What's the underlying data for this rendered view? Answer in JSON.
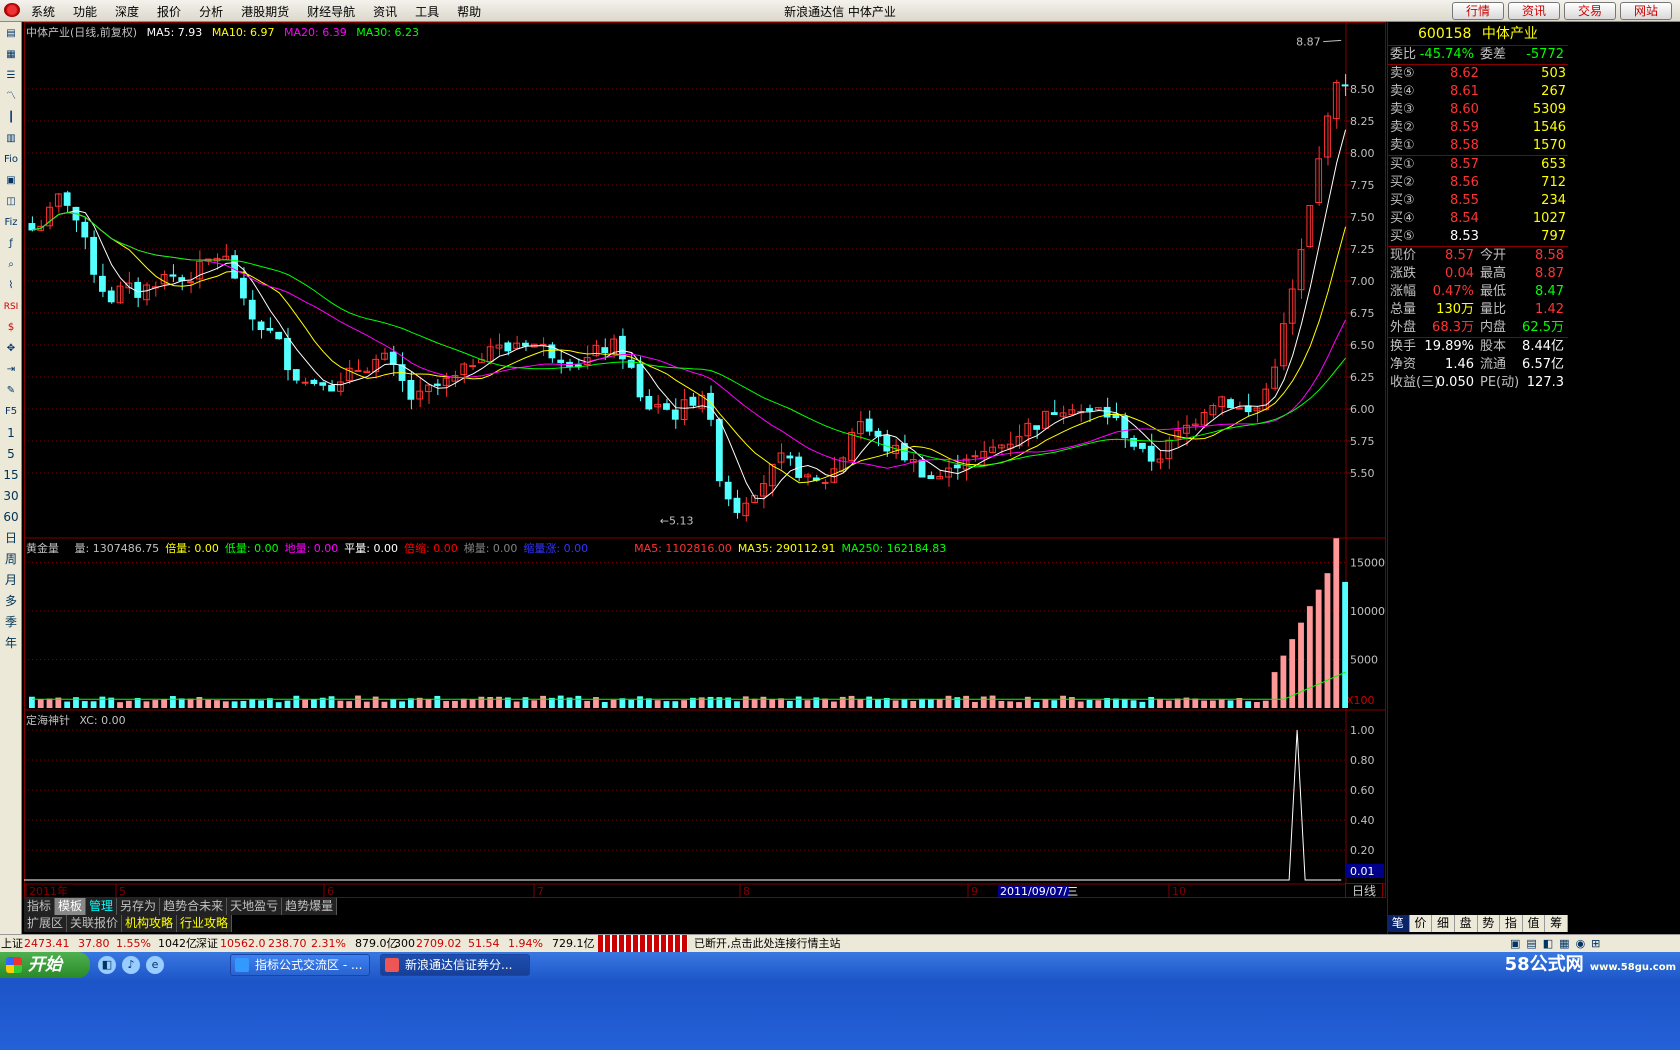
{
  "menu": {
    "items": [
      "系统",
      "功能",
      "深度",
      "报价",
      "分析",
      "港股期货",
      "财经导航",
      "资讯",
      "工具",
      "帮助"
    ],
    "title": "新浪通达信  中体产业",
    "buttons": [
      "行情",
      "资讯",
      "交易",
      "网站"
    ]
  },
  "left_tools": {
    "icons": [
      "page-icon",
      "grid-icon",
      "list-icon",
      "line-chart-icon",
      "candle-chart-icon",
      "table-icon",
      "f10-icon",
      "calc-icon",
      "info-icon",
      "fiz-icon",
      "fx-icon",
      "search-icon",
      "tick-icon",
      "rsi-icon",
      "money-icon",
      "move-icon",
      "export-icon",
      "pencil-icon",
      "f5-icon"
    ],
    "labels": [
      "Fio",
      "Fiz",
      "RSI",
      "F5"
    ],
    "periods": [
      "1",
      "5",
      "15",
      "30",
      "60"
    ],
    "periods2": [
      "日",
      "周",
      "月",
      "多",
      "季",
      "年"
    ]
  },
  "kline": {
    "name": "中体产业(日线,前复权)",
    "ma5": "MA5: 7.93",
    "ma10": "MA10: 6.97",
    "ma20": "MA20: 6.39",
    "ma30": "MA30: 6.23",
    "high_label": "8.87",
    "low_label": "5.13",
    "price_ticks": [
      "8.50",
      "8.25",
      "8.00",
      "7.75",
      "7.50",
      "7.25",
      "7.00",
      "6.75",
      "6.50",
      "6.25",
      "6.00",
      "5.75",
      "5.50"
    ]
  },
  "volume": {
    "name": "黄金量",
    "fields": [
      {
        "label": "量: 1307486.75",
        "color": "#c0c0c0"
      },
      {
        "label": "倍量: 0.00",
        "color": "#ffff00"
      },
      {
        "label": "低量: 0.00",
        "color": "#00ff00"
      },
      {
        "label": "地量: 0.00",
        "color": "#ff00ff"
      },
      {
        "label": "平量: 0.00",
        "color": "#ffffff"
      },
      {
        "label": "倍缩: 0.00",
        "color": "#ff0000"
      },
      {
        "label": "梯量: 0.00",
        "color": "#808080"
      },
      {
        "label": "缩量涨: 0.00",
        "color": "#3333ff"
      },
      {
        "label": "MA5: 1102816.00",
        "color": "#ff3333"
      },
      {
        "label": "MA35: 290112.91",
        "color": "#ffff00"
      },
      {
        "label": "MA250: 162184.83",
        "color": "#00ff00"
      }
    ],
    "ticks": [
      "15000",
      "10000",
      "5000"
    ],
    "unit": "X100"
  },
  "indicator": {
    "name": "定海神针",
    "xc": "XC: 0.00",
    "ticks": [
      "1.00",
      "0.80",
      "0.60",
      "0.40",
      "0.20"
    ],
    "cur_value": "0.01"
  },
  "date_axis": {
    "labels": [
      "2011年",
      "5",
      "6",
      "7",
      "8",
      "9",
      "10"
    ],
    "highlight": "2011/09/07/三",
    "period": "日线"
  },
  "bottom_tabs": {
    "row1": [
      "指标",
      "模板",
      "管理",
      "另存为",
      "趋势合未来",
      "天地盈亏",
      "趋势爆量"
    ],
    "row2": [
      "扩展区",
      "关联报价",
      "机构攻略",
      "行业攻略"
    ]
  },
  "quote": {
    "code": "600158",
    "name": "中体产业",
    "weibi_label": "委比",
    "weibi": "-45.74%",
    "weicha_label": "委差",
    "weicha": "-5772",
    "sells": [
      {
        "label": "卖⑤",
        "price": "8.62",
        "vol": "503"
      },
      {
        "label": "卖④",
        "price": "8.61",
        "vol": "267"
      },
      {
        "label": "卖③",
        "price": "8.60",
        "vol": "5309"
      },
      {
        "label": "卖②",
        "price": "8.59",
        "vol": "1546"
      },
      {
        "label": "卖①",
        "price": "8.58",
        "vol": "1570"
      }
    ],
    "buys": [
      {
        "label": "买①",
        "price": "8.57",
        "vol": "653"
      },
      {
        "label": "买②",
        "price": "8.56",
        "vol": "712"
      },
      {
        "label": "买③",
        "price": "8.55",
        "vol": "234"
      },
      {
        "label": "买④",
        "price": "8.54",
        "vol": "1027"
      },
      {
        "label": "买⑤",
        "price": "8.53",
        "vol": "797"
      }
    ],
    "stats": [
      [
        {
          "l": "现价",
          "v": "8.57",
          "c": "red"
        },
        {
          "l": "今开",
          "v": "8.58",
          "c": "red"
        }
      ],
      [
        {
          "l": "涨跌",
          "v": "0.04",
          "c": "red"
        },
        {
          "l": "最高",
          "v": "8.87",
          "c": "red"
        }
      ],
      [
        {
          "l": "涨幅",
          "v": "0.47%",
          "c": "red"
        },
        {
          "l": "最低",
          "v": "8.47",
          "c": "green"
        }
      ],
      [
        {
          "l": "总量",
          "v": "130万",
          "c": "yellow"
        },
        {
          "l": "量比",
          "v": "1.42",
          "c": "red"
        }
      ],
      [
        {
          "l": "外盘",
          "v": "68.3万",
          "c": "red"
        },
        {
          "l": "内盘",
          "v": "62.5万",
          "c": "green"
        }
      ]
    ],
    "stats2": [
      [
        {
          "l": "换手",
          "v": "19.89%",
          "c": "white"
        },
        {
          "l": "股本",
          "v": "8.44亿",
          "c": "white"
        }
      ],
      [
        {
          "l": "净资",
          "v": "1.46",
          "c": "white"
        },
        {
          "l": "流通",
          "v": "6.57亿",
          "c": "white"
        }
      ],
      [
        {
          "l": "收益(三)",
          "v": "0.050",
          "c": "white"
        },
        {
          "l": "PE(动)",
          "v": "127.3",
          "c": "white"
        }
      ]
    ],
    "tabs": [
      "笔",
      "价",
      "细",
      "盘",
      "势",
      "指",
      "值",
      "筹"
    ]
  },
  "statusbar": {
    "sh_label": "上证",
    "sh_index": "2473.41",
    "sh_change": "37.80",
    "sh_pct": "1.55%",
    "sh_amount": "1042亿",
    "sz_label": "深证",
    "sz_index": "10562.0",
    "sz_change": "238.70",
    "sz_pct": "2.31%",
    "sz_amount": "879.0亿",
    "hs_label": "300",
    "hs_index": "2709.02",
    "hs_change": "51.54",
    "hs_pct": "1.94%",
    "hs_amount": "729.1亿",
    "message": "已断开,点击此处连接行情主站"
  },
  "taskbar": {
    "start": "开始",
    "tasks": [
      "指标公式交流区 - ...",
      "新浪通达信证券分..."
    ],
    "watermark": "58公式网",
    "watermark_url": "www.58gu.com"
  },
  "colors": {
    "up": "#ff3333",
    "down": "#54ffff",
    "ma5": "#ffffff",
    "ma10": "#ffff00",
    "ma20": "#ff00ff",
    "ma30": "#00ff00",
    "grid": "#800000"
  }
}
